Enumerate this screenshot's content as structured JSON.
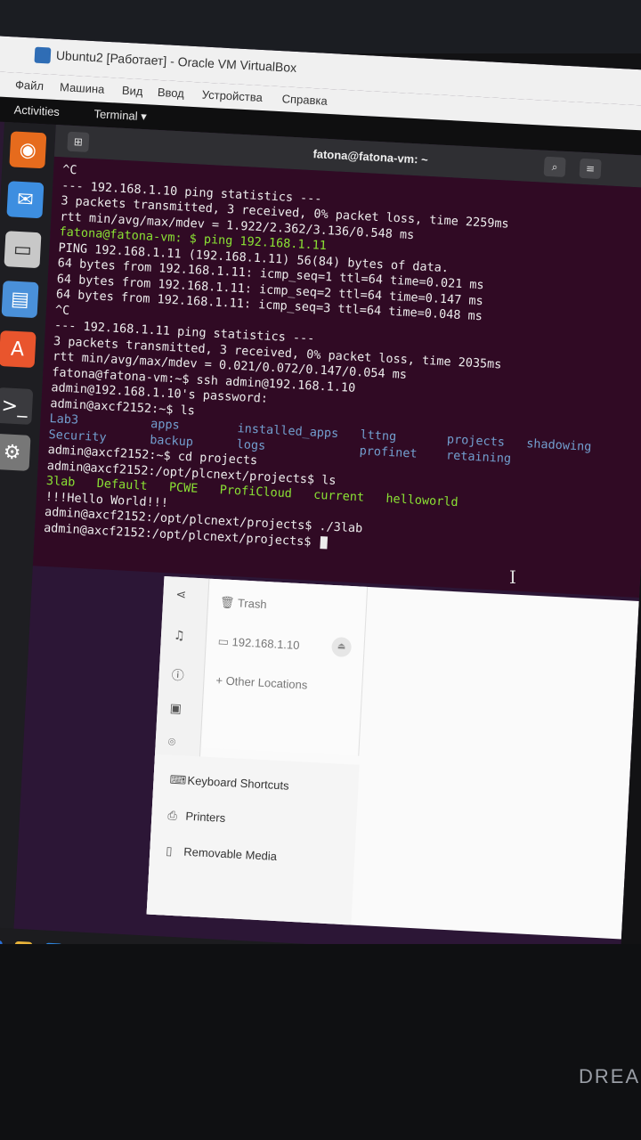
{
  "window": {
    "title": "Ubuntu2 [Работает] - Oracle VM VirtualBox",
    "menu": [
      "Файл",
      "Машина",
      "Вид",
      "Ввод",
      "Устройства",
      "Справка"
    ]
  },
  "gnome": {
    "activities": "Activities",
    "terminal_label": "Terminal ▾"
  },
  "terminal": {
    "title": "fatona@fatona-vm: ~",
    "lines": [
      "^C",
      "--- 192.168.1.10 ping statistics ---",
      "3 packets transmitted, 3 received, 0% packet loss, time 2259ms",
      "rtt min/avg/max/mdev = 1.922/2.362/3.136/0.548 ms",
      "fatona@fatona-vm: $ ping 192.168.1.11",
      "PING 192.168.1.11 (192.168.1.11) 56(84) bytes of data.",
      "64 bytes from 192.168.1.11: icmp_seq=1 ttl=64 time=0.021 ms",
      "64 bytes from 192.168.1.11: icmp_seq=2 ttl=64 time=0.147 ms",
      "64 bytes from 192.168.1.11: icmp_seq=3 ttl=64 time=0.048 ms",
      "^C",
      "--- 192.168.1.11 ping statistics ---",
      "3 packets transmitted, 3 received, 0% packet loss, time 2035ms",
      "rtt min/avg/max/mdev = 0.021/0.072/0.147/0.054 ms",
      "fatona@fatona-vm:~$ ssh admin@192.168.1.10",
      "admin@192.168.1.10's password:",
      "admin@axcf2152:~$ ls",
      "Lab3          apps        installed_apps   lttng       projects   shadowing",
      "Security      backup      logs             profinet    retaining",
      "admin@axcf2152:~$ cd projects",
      "admin@axcf2152:/opt/plcnext/projects$ ls",
      "3lab   Default   PCWE   ProfiCloud   current   helloworld",
      "!!!Hello World!!!",
      "admin@axcf2152:/opt/plcnext/projects$ ./3lab",
      "admin@axcf2152:/opt/plcnext/projects$ "
    ]
  },
  "files": {
    "sidebar": [
      "Trash",
      "192.168.1.10",
      "Other Locations"
    ],
    "settings": [
      "Keyboard Shortcuts",
      "Printers",
      "Removable Media"
    ]
  },
  "bezel": {
    "brand": "DREA"
  },
  "colors": {
    "terminal_bg": "#300a24",
    "prompt_green": "#8ae234",
    "dir_blue": "#729fcf"
  }
}
